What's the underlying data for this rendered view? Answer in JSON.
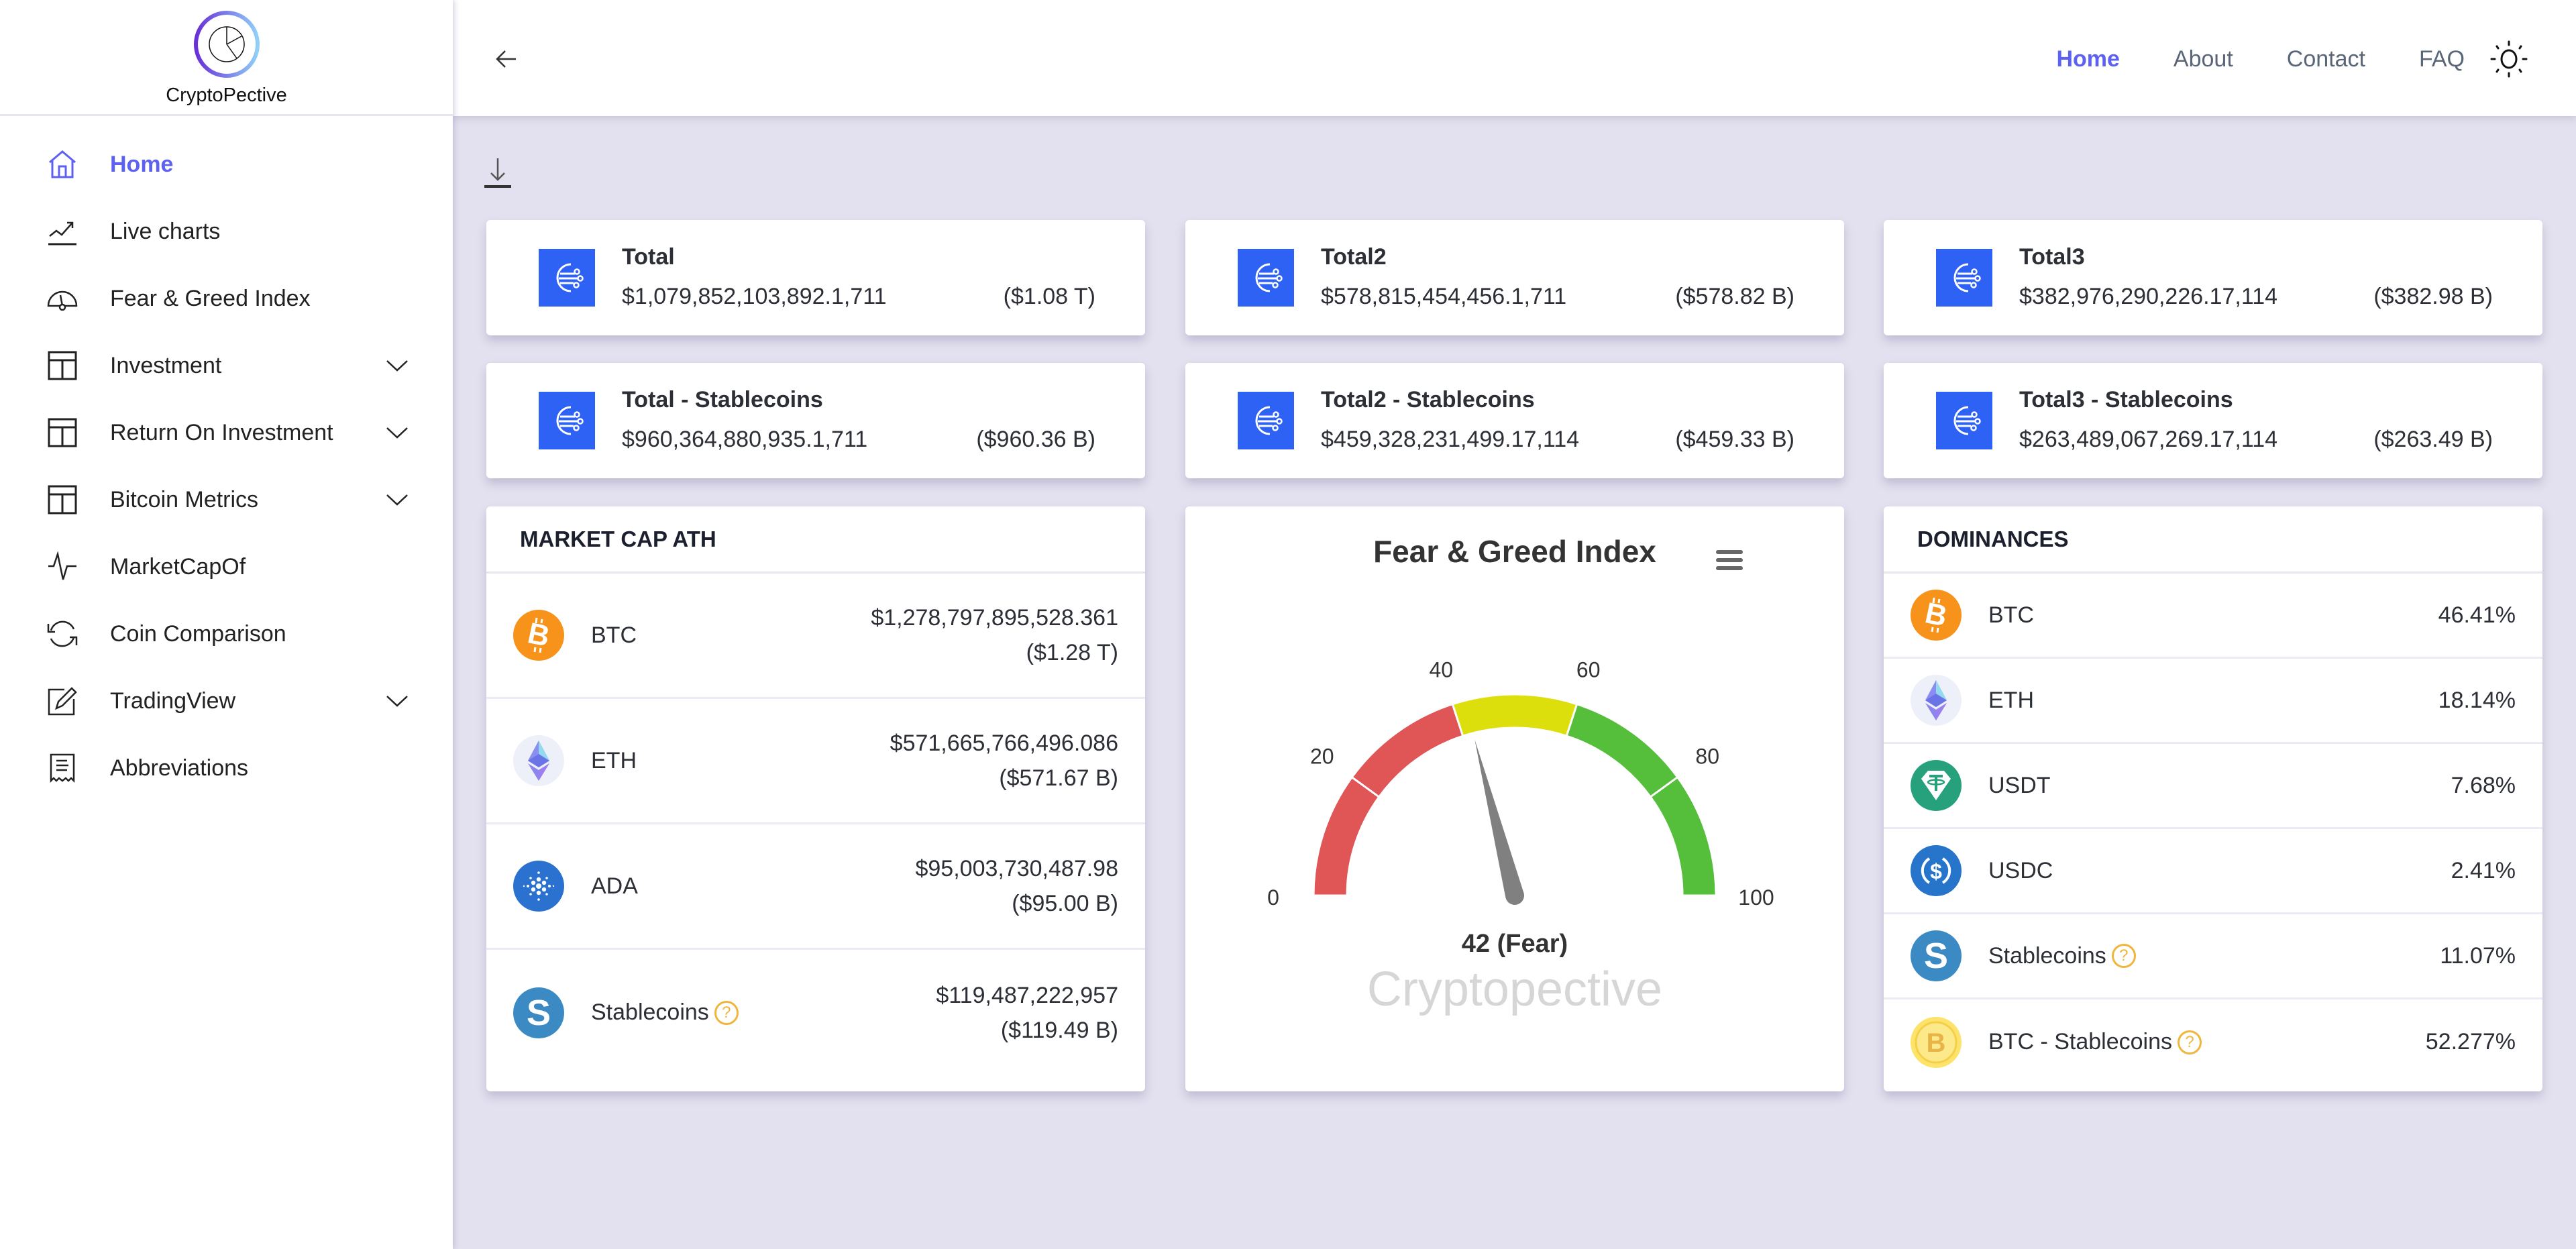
{
  "brand": {
    "name": "CryptoPective"
  },
  "sidebar": {
    "items": [
      {
        "label": "Home",
        "icon": "home-icon",
        "active": true,
        "expandable": false
      },
      {
        "label": "Live charts",
        "icon": "trending-up-icon",
        "active": false,
        "expandable": false
      },
      {
        "label": "Fear & Greed Index",
        "icon": "gauge-icon",
        "active": false,
        "expandable": false
      },
      {
        "label": "Investment",
        "icon": "layout-icon",
        "active": false,
        "expandable": true
      },
      {
        "label": "Return On Investment",
        "icon": "layout-icon",
        "active": false,
        "expandable": true
      },
      {
        "label": "Bitcoin Metrics",
        "icon": "layout-icon",
        "active": false,
        "expandable": true
      },
      {
        "label": "MarketCapOf",
        "icon": "pulse-icon",
        "active": false,
        "expandable": false
      },
      {
        "label": "Coin Comparison",
        "icon": "sync-icon",
        "active": false,
        "expandable": false
      },
      {
        "label": "TradingView",
        "icon": "edit-icon",
        "active": false,
        "expandable": true
      },
      {
        "label": "Abbreviations",
        "icon": "receipt-icon",
        "active": false,
        "expandable": false
      }
    ]
  },
  "header": {
    "nav": [
      {
        "label": "Home",
        "active": true
      },
      {
        "label": "About",
        "active": false
      },
      {
        "label": "Contact",
        "active": false
      },
      {
        "label": "FAQ",
        "active": false
      }
    ],
    "theme_toggle_icon": "sun-icon"
  },
  "stats": [
    {
      "title": "Total",
      "value": "$1,079,852,103,892.1,711",
      "short": "($1.08 T)"
    },
    {
      "title": "Total2",
      "value": "$578,815,454,456.1,711",
      "short": "($578.82 B)"
    },
    {
      "title": "Total3",
      "value": "$382,976,290,226.17,114",
      "short": "($382.98 B)"
    },
    {
      "title": "Total - Stablecoins",
      "value": "$960,364,880,935.1,711",
      "short": "($960.36 B)"
    },
    {
      "title": "Total2 - Stablecoins",
      "value": "$459,328,231,499.17,114",
      "short": "($459.33 B)"
    },
    {
      "title": "Total3 - Stablecoins",
      "value": "$263,489,067,269.17,114",
      "short": "($263.49 B)"
    }
  ],
  "market_cap_ath": {
    "title": "MARKET CAP ATH",
    "rows": [
      {
        "coin": "BTC",
        "value": "$1,278,797,895,528.361",
        "short": "($1.28 T)",
        "help": false
      },
      {
        "coin": "ETH",
        "value": "$571,665,766,496.086",
        "short": "($571.67 B)",
        "help": false
      },
      {
        "coin": "ADA",
        "value": "$95,003,730,487.98",
        "short": "($95.00 B)",
        "help": false
      },
      {
        "coin": "Stablecoins",
        "value": "$119,487,222,957",
        "short": "($119.49 B)",
        "help": true
      }
    ]
  },
  "fear_greed": {
    "title": "Fear & Greed Index",
    "value": 42,
    "label": "42 (Fear)",
    "watermark": "Cryptopective",
    "min": 0,
    "max": 100,
    "ticks": [
      0,
      20,
      40,
      60,
      80,
      100
    ],
    "bands": [
      {
        "from": 0,
        "to": 20,
        "color": "#e05555"
      },
      {
        "from": 20,
        "to": 40,
        "color": "#e05555"
      },
      {
        "from": 40,
        "to": 60,
        "color": "#dddf0d"
      },
      {
        "from": 60,
        "to": 80,
        "color": "#55bf3b"
      },
      {
        "from": 80,
        "to": 100,
        "color": "#55bf3b"
      }
    ]
  },
  "dominances": {
    "title": "DOMINANCES",
    "rows": [
      {
        "coin": "BTC",
        "value": "46.41%",
        "help": false
      },
      {
        "coin": "ETH",
        "value": "18.14%",
        "help": false
      },
      {
        "coin": "USDT",
        "value": "7.68%",
        "help": false
      },
      {
        "coin": "USDC",
        "value": "2.41%",
        "help": false
      },
      {
        "coin": "Stablecoins",
        "value": "11.07%",
        "help": true
      },
      {
        "coin": "BTC - Stablecoins",
        "value": "52.277%",
        "help": true
      }
    ]
  },
  "colors": {
    "accent": "#5c61f2",
    "stat_icon_bg": "#2d62f5",
    "page_bg": "#e3e1ef",
    "btc": "#f7931a",
    "ada": "#2a71d0",
    "usdt": "#26a17b",
    "usdc": "#2775ca",
    "stable": "#3b8ac4",
    "help": "#f0b63c"
  }
}
